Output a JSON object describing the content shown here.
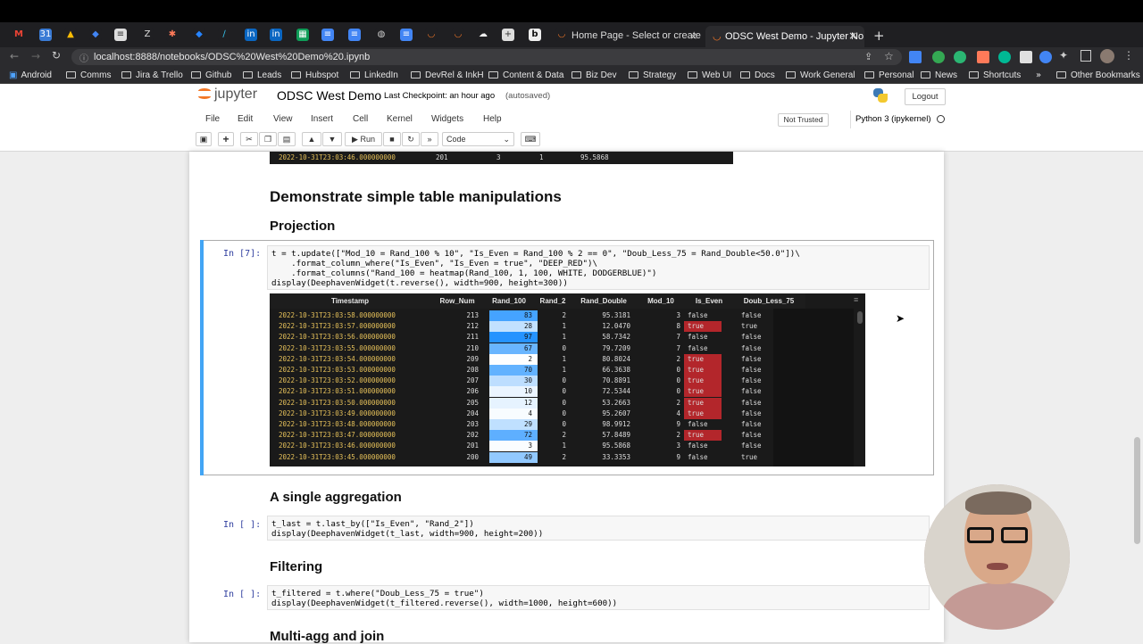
{
  "browser": {
    "tabs": [
      {
        "label": "Home Page - Select or create a"
      },
      {
        "label": "ODSC West Demo - Jupyter No"
      }
    ],
    "url": "localhost:8888/notebooks/ODSC%20West%20Demo%20.ipynb",
    "bookmarks": [
      "Android",
      "Comms",
      "Jira & Trello",
      "Github",
      "Leads",
      "Hubspot",
      "LinkedIn",
      "DevRel & InkH",
      "Content & Data",
      "Biz Dev",
      "Strategy",
      "Web UI",
      "Docs",
      "Work General",
      "Personal",
      "News",
      "Shortcuts",
      "Other Bookmarks"
    ]
  },
  "jupyter": {
    "logo_text": "jupyter",
    "notebook_title": "ODSC West Demo",
    "checkpoint": "Last Checkpoint: an hour ago",
    "autosaved": "(autosaved)",
    "logout": "Logout",
    "menu": [
      "File",
      "Edit",
      "View",
      "Insert",
      "Cell",
      "Kernel",
      "Widgets",
      "Help"
    ],
    "not_trusted": "Not Trusted",
    "kernel": "Python 3 (ipykernel)",
    "run_label": "Run",
    "cell_type": "Code"
  },
  "notebook": {
    "top_row": {
      "ts": "2022-10-31T23:03:46.000000000",
      "row": "201",
      "r100": "3",
      "r2": "1",
      "rd": "95.5868"
    },
    "heading_table": "Demonstrate simple table manipulations",
    "heading_projection": "Projection",
    "prompt_7": "In [7]:",
    "code_7": [
      "t = t.update([\"Mod_10 = Rand_100 % 10\", \"Is_Even = Rand_100 % 2 == 0\", \"Doub_Less_75 = Rand_Double<50.0\"])\\",
      "    .format_column_where(\"Is_Even\", \"Is_Even = true\", \"DEEP_RED\")\\",
      "    .format_columns(\"Rand_100 = heatmap(Rand_100, 1, 100, WHITE, DODGERBLUE)\")",
      "display(DeephavenWidget(t.reverse(), width=900, height=300))"
    ],
    "heading_agg": "A single aggregation",
    "prompt_agg": "In [ ]:",
    "code_agg": [
      "t_last = t.last_by([\"Is_Even\", \"Rand_2\"])",
      "display(DeephavenWidget(t_last, width=900, height=200))"
    ],
    "heading_filter": "Filtering",
    "prompt_filter": "In [ ]:",
    "code_filter": [
      "t_filtered = t.where(\"Doub_Less_75 = true\")",
      "display(DeephavenWidget(t_filtered.reverse(), width=1000, height=600))"
    ],
    "heading_multi": "Multi-agg and join"
  },
  "table": {
    "columns": [
      "Timestamp",
      "Row_Num",
      "Rand_100",
      "Rand_2",
      "Rand_Double",
      "Mod_10",
      "Is_Even",
      "Doub_Less_75"
    ],
    "rows": [
      [
        "2022-10-31T23:03:58.000000000",
        "213",
        "83",
        "2",
        "95.3181",
        "3",
        "false",
        "false"
      ],
      [
        "2022-10-31T23:03:57.000000000",
        "212",
        "28",
        "1",
        "12.0470",
        "8",
        "true",
        "true"
      ],
      [
        "2022-10-31T23:03:56.000000000",
        "211",
        "97",
        "1",
        "58.7342",
        "7",
        "false",
        "false"
      ],
      [
        "2022-10-31T23:03:55.000000000",
        "210",
        "67",
        "0",
        "79.7209",
        "7",
        "false",
        "false"
      ],
      [
        "2022-10-31T23:03:54.000000000",
        "209",
        "2",
        "1",
        "80.8024",
        "2",
        "true",
        "false"
      ],
      [
        "2022-10-31T23:03:53.000000000",
        "208",
        "70",
        "1",
        "66.3638",
        "0",
        "true",
        "false"
      ],
      [
        "2022-10-31T23:03:52.000000000",
        "207",
        "30",
        "0",
        "70.8891",
        "0",
        "true",
        "false"
      ],
      [
        "2022-10-31T23:03:51.000000000",
        "206",
        "10",
        "0",
        "72.5344",
        "0",
        "true",
        "false"
      ],
      [
        "2022-10-31T23:03:50.000000000",
        "205",
        "12",
        "0",
        "53.2663",
        "2",
        "true",
        "false"
      ],
      [
        "2022-10-31T23:03:49.000000000",
        "204",
        "4",
        "0",
        "95.2607",
        "4",
        "true",
        "false"
      ],
      [
        "2022-10-31T23:03:48.000000000",
        "203",
        "29",
        "0",
        "98.9912",
        "9",
        "false",
        "false"
      ],
      [
        "2022-10-31T23:03:47.000000000",
        "202",
        "72",
        "2",
        "57.8489",
        "2",
        "true",
        "false"
      ],
      [
        "2022-10-31T23:03:46.000000000",
        "201",
        "3",
        "1",
        "95.5868",
        "3",
        "false",
        "false"
      ],
      [
        "2022-10-31T23:03:45.000000000",
        "200",
        "49",
        "2",
        "33.3353",
        "9",
        "false",
        "true"
      ]
    ]
  },
  "colors": {
    "deep_red": "#b3262b",
    "dodgerblue": "#1e90ff",
    "timestamp": "#e6c15a",
    "cell_selected": "#42a5f5"
  }
}
